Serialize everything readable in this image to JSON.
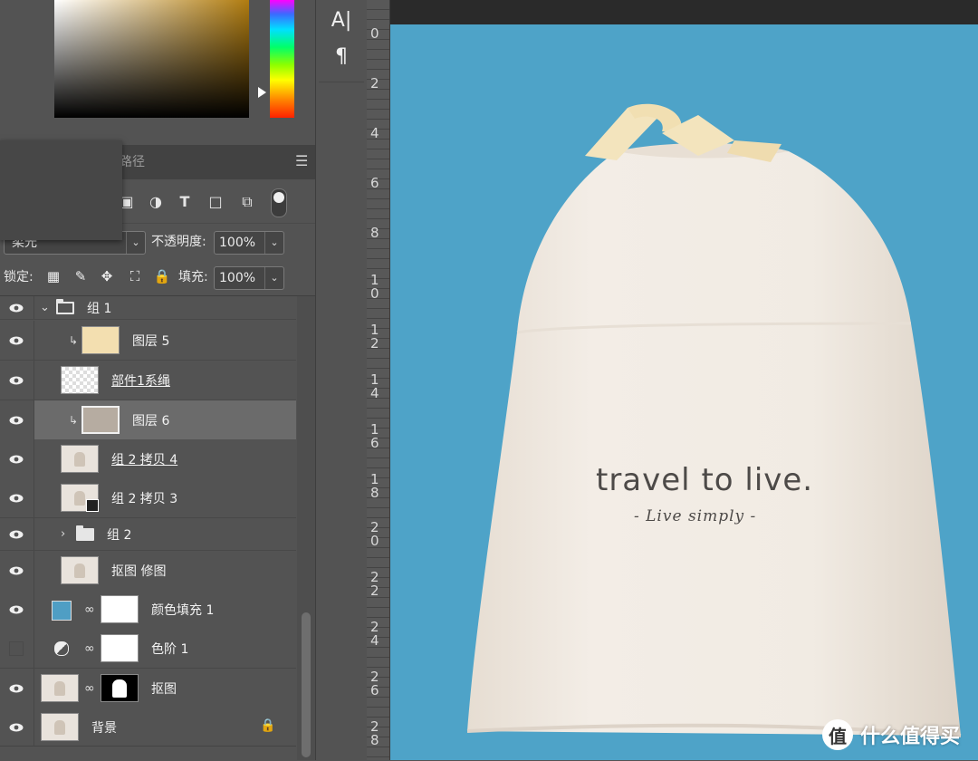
{
  "panel": {
    "tab_paths": "路径",
    "blend_mode": "柔光",
    "opacity_label": "不透明度:",
    "opacity_value": "100%",
    "lock_label": "锁定:",
    "fill_label": "填充:",
    "fill_value": "100%",
    "filter_icons": [
      "image-filter-icon",
      "adjustment-filter-icon",
      "type-filter-icon",
      "shape-filter-icon",
      "smart-object-filter-icon"
    ]
  },
  "layers": [
    {
      "name": "组 1",
      "kind": "group-open",
      "visible": true
    },
    {
      "name": "图层 5",
      "kind": "clipped-color",
      "thumb_color": "#f3dfb0",
      "visible": true
    },
    {
      "name": "部件1系绳",
      "kind": "transparent",
      "underline": true,
      "visible": true
    },
    {
      "name": "图层 6",
      "kind": "clipped-color",
      "thumb_color": "#b6aca1",
      "selected": true,
      "visible": true
    },
    {
      "name": "组 2 拷贝 4",
      "kind": "bag",
      "underline": true,
      "visible": true
    },
    {
      "name": "组 2 拷贝 3",
      "kind": "bag-smart",
      "visible": true
    },
    {
      "name": "组 2",
      "kind": "group-closed",
      "visible": true
    },
    {
      "name": "抠图 修图",
      "kind": "bag",
      "visible": true
    },
    {
      "name": "颜色填充 1",
      "kind": "fill",
      "fill_color": "#4f9ec4",
      "visible": true
    },
    {
      "name": "色阶 1",
      "kind": "levels",
      "visible": false
    },
    {
      "name": "抠图",
      "kind": "masked",
      "visible": true
    },
    {
      "name": "背景",
      "kind": "background",
      "locked": true,
      "visible": true
    }
  ],
  "tools": {
    "type_tool": "A|",
    "paragraph_tool": "¶"
  },
  "ruler": {
    "marks": [
      "0",
      "2",
      "4",
      "6",
      "8",
      "1\n0",
      "1\n2",
      "1\n4",
      "1\n6",
      "1\n8",
      "2\n0",
      "2\n2",
      "2\n4",
      "2\n6",
      "2\n8"
    ]
  },
  "canvas": {
    "background_color": "#4ea3c8",
    "bag_text_title": "travel to live.",
    "bag_text_sub": "- Live simply -"
  },
  "watermark": {
    "logo": "值",
    "text": "什么值得买"
  }
}
